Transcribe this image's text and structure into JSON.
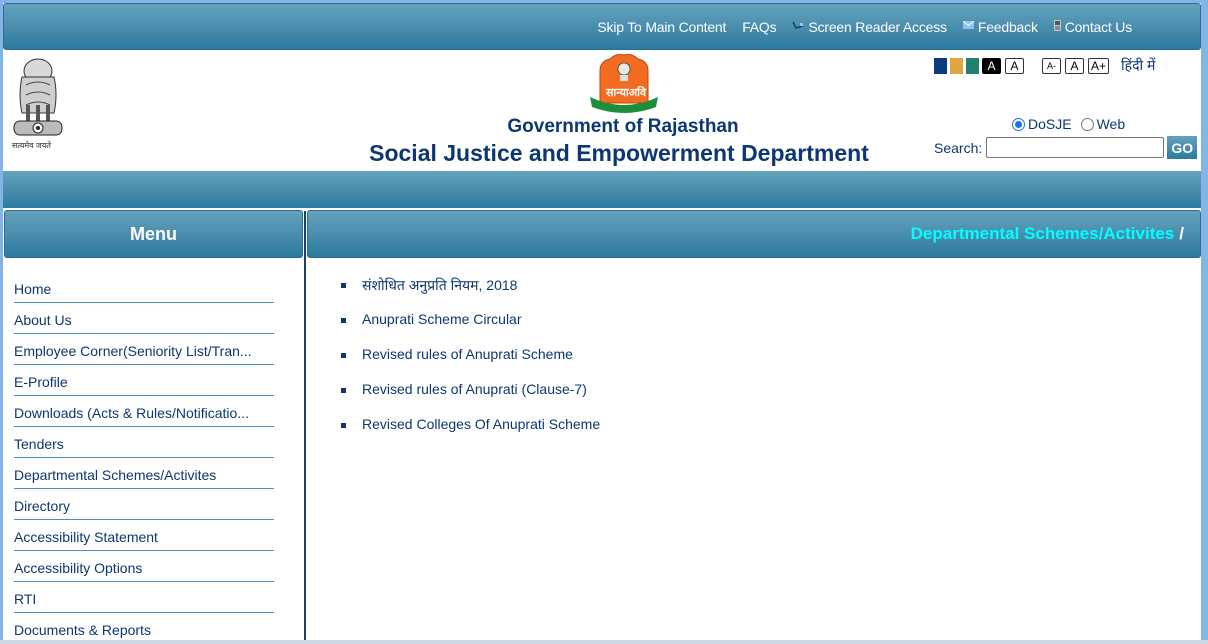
{
  "topbar": {
    "links": [
      {
        "label": "Skip To Main Content",
        "icon": ""
      },
      {
        "label": "FAQs",
        "icon": ""
      },
      {
        "label": "Screen Reader Access",
        "icon": "screen-reader-icon"
      },
      {
        "label": "Feedback",
        "icon": "mail-icon"
      },
      {
        "label": "Contact Us",
        "icon": "phone-icon"
      }
    ]
  },
  "header": {
    "gov_title": "Government of Rajasthan",
    "dept_title": "Social Justice and Empowerment Department",
    "emblem_motto": "सत्यमेव जयते",
    "logo_text": "सान्याअवि"
  },
  "accessibility": {
    "color_themes": [
      "#0a3a80",
      "#e0a640",
      "#22806e"
    ],
    "contrast_buttons": [
      {
        "label": "A",
        "style": "high-contrast"
      },
      {
        "label": "A",
        "style": "normal"
      }
    ],
    "font_buttons": [
      {
        "label": "A-",
        "action": "decrease"
      },
      {
        "label": "A",
        "action": "reset"
      },
      {
        "label": "A+",
        "action": "increase"
      }
    ],
    "language_link": "हिंदी में"
  },
  "search": {
    "scope_options": [
      {
        "label": "DoSJE",
        "selected": true
      },
      {
        "label": "Web",
        "selected": false
      }
    ],
    "label": "Search:",
    "value": "",
    "placeholder": "",
    "button_label": "GO"
  },
  "menu": {
    "title": "Menu",
    "items": [
      "Home",
      "About Us",
      "Employee Corner(Seniority List/Tran...",
      "E-Profile",
      "Downloads (Acts & Rules/Notificatio...",
      "Tenders",
      "Departmental Schemes/Activites",
      "Directory",
      "Accessibility Statement",
      "Accessibility Options",
      "RTI",
      "Documents & Reports"
    ]
  },
  "content": {
    "breadcrumb": "Departmental Schemes/Activites",
    "breadcrumb_separator": "/",
    "items": [
      "संशोधित अनुप्रति नियम, 2018",
      "Anuprati Scheme Circular",
      "Revised rules of Anuprati Scheme",
      "Revised rules of Anuprati (Clause-7)",
      "Revised Colleges Of Anuprati Scheme"
    ]
  },
  "colors": {
    "header_gradient_top": "#64a2bc",
    "header_gradient_bottom": "#2a7aa0",
    "title_blue": "#0c3772",
    "breadcrumb_cyan": "#00ffff",
    "page_border": "#82b4e6"
  }
}
